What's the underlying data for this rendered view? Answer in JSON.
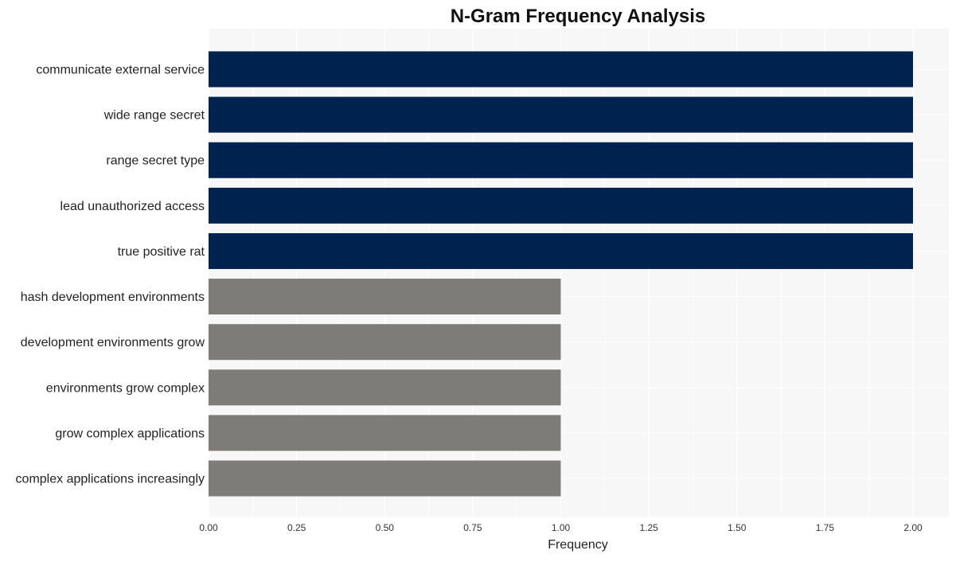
{
  "chart_data": {
    "type": "bar",
    "orientation": "horizontal",
    "title": "N-Gram Frequency Analysis",
    "xlabel": "Frequency",
    "ylabel": "",
    "xlim": [
      0,
      2.1
    ],
    "x_ticks": [
      "0.00",
      "0.25",
      "0.50",
      "0.75",
      "1.00",
      "1.25",
      "1.50",
      "1.75",
      "2.00"
    ],
    "x_tick_values": [
      0,
      0.25,
      0.5,
      0.75,
      1.0,
      1.25,
      1.5,
      1.75,
      2.0
    ],
    "grid": true,
    "categories": [
      "communicate external service",
      "wide range secret",
      "range secret type",
      "lead unauthorized access",
      "true positive rat",
      "hash development environments",
      "development environments grow",
      "environments grow complex",
      "grow complex applications",
      "complex applications increasingly"
    ],
    "values": [
      2,
      2,
      2,
      2,
      2,
      1,
      1,
      1,
      1,
      1
    ],
    "colors": [
      "#00224e",
      "#00224e",
      "#00224e",
      "#00224e",
      "#00224e",
      "#7d7c78",
      "#7d7c78",
      "#7d7c78",
      "#7d7c78",
      "#7d7c78"
    ],
    "background": "#f7f7f7"
  }
}
